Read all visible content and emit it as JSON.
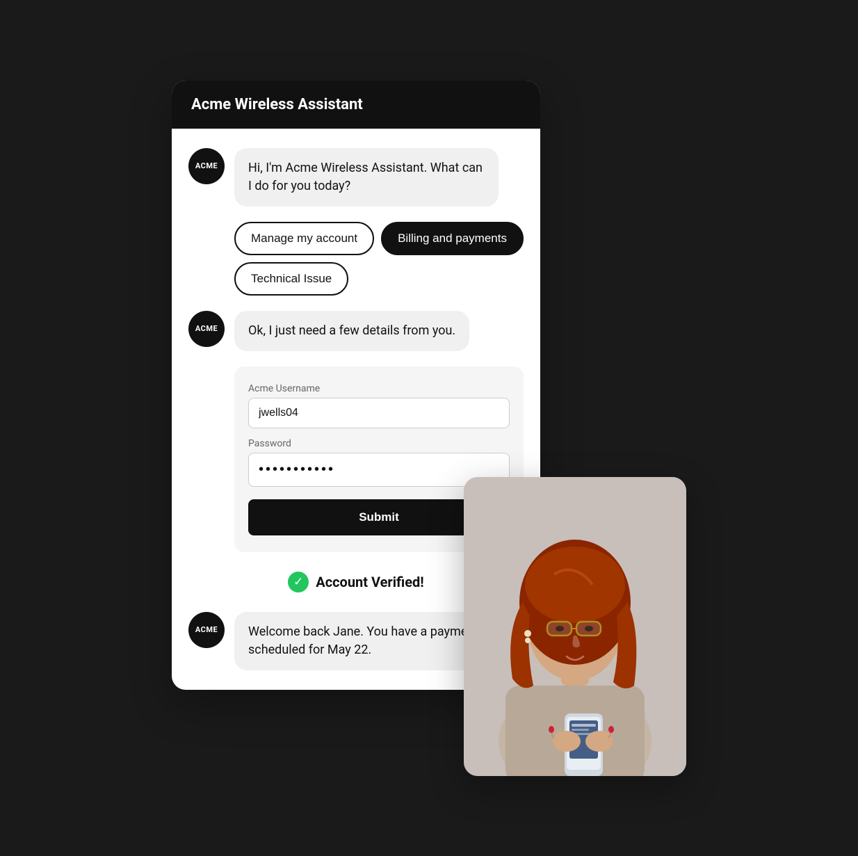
{
  "app": {
    "title": "Acme Wireless Assistant"
  },
  "avatar": {
    "label": "ACME"
  },
  "messages": [
    {
      "id": "greeting",
      "text": "Hi, I'm Acme Wireless Assistant. What can I do for you today?"
    },
    {
      "id": "details",
      "text": "Ok, I just need a few details from you."
    },
    {
      "id": "welcome",
      "text": "Welcome back Jane. You have a payment scheduled for May 22."
    }
  ],
  "quickReplies": [
    {
      "id": "manage",
      "label": "Manage my account",
      "selected": false
    },
    {
      "id": "billing",
      "label": "Billing and payments",
      "selected": true
    },
    {
      "id": "technical",
      "label": "Technical Issue",
      "selected": false
    }
  ],
  "form": {
    "usernameLabel": "Acme Username",
    "usernamePlaceholder": "jwells04",
    "usernameValue": "jwells04",
    "passwordLabel": "Password",
    "passwordValue": "••••••••••",
    "submitLabel": "Submit"
  },
  "verified": {
    "text": "Account Verified!"
  },
  "photo": {
    "altText": "Woman with red hair looking at phone"
  }
}
